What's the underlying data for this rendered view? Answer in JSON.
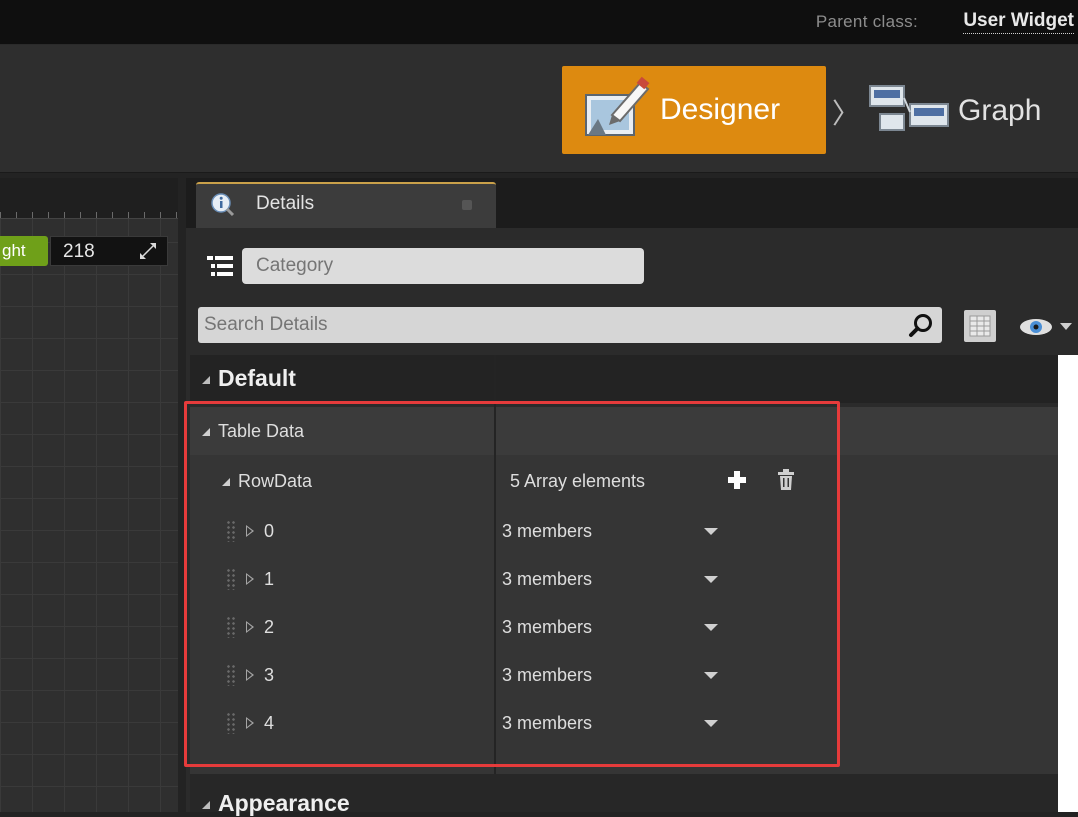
{
  "header": {
    "parent_class_label": "Parent class:",
    "parent_class_value": "User Widget"
  },
  "modes": {
    "designer_label": "Designer",
    "separator": "〉",
    "graph_label": "Graph",
    "active": "Designer",
    "active_color": "#dd8a10"
  },
  "canvas": {
    "height_label": "ght",
    "height_value": "218"
  },
  "details": {
    "tab_label": "Details",
    "category_placeholder": "Category",
    "search_placeholder": "Search Details"
  },
  "sections": {
    "default_title": "Default",
    "appearance_title": "Appearance"
  },
  "table_data": {
    "label": "Table Data",
    "row_data_label": "RowData",
    "row_data_value": "5 Array elements",
    "elements": [
      {
        "index": "0",
        "value": "3 members"
      },
      {
        "index": "1",
        "value": "3 members"
      },
      {
        "index": "2",
        "value": "3 members"
      },
      {
        "index": "3",
        "value": "3 members"
      },
      {
        "index": "4",
        "value": "3 members"
      }
    ]
  },
  "colors": {
    "highlight": "#e63b3b",
    "height_tag": "#6fa019"
  },
  "icons": [
    "info-icon",
    "category-list-icon",
    "search-icon",
    "grid-view-icon",
    "eye-icon",
    "add-icon",
    "trash-icon",
    "resize-icon",
    "designer-icon",
    "graph-icon"
  ]
}
